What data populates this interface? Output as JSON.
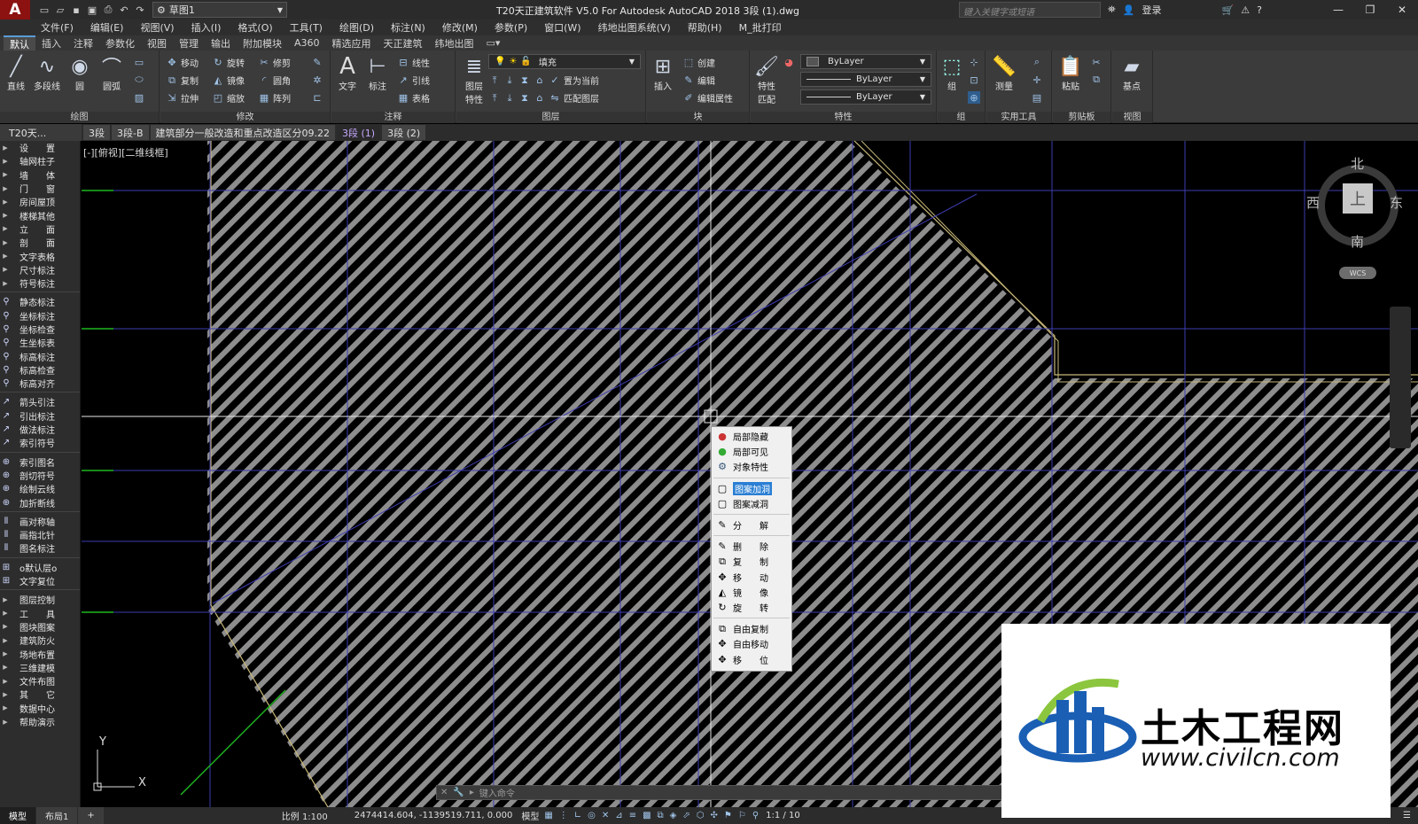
{
  "title_bar": {
    "logo": "A",
    "workspace": "草图1",
    "title": "T20天正建筑软件 V5.0 For Autodesk AutoCAD 2018    3段 (1).dwg",
    "search_placeholder": "键入关键字或短语",
    "login": "登录"
  },
  "menus": [
    "文件(F)",
    "编辑(E)",
    "视图(V)",
    "插入(I)",
    "格式(O)",
    "工具(T)",
    "绘图(D)",
    "标注(N)",
    "修改(M)",
    "参数(P)",
    "窗口(W)",
    "纬地出图系统(V)",
    "帮助(H)",
    "M_批打印"
  ],
  "ribbon_tabs": [
    "默认",
    "插入",
    "注释",
    "参数化",
    "视图",
    "管理",
    "输出",
    "附加模块",
    "A360",
    "精选应用",
    "天正建筑",
    "纬地出图"
  ],
  "ribbon": {
    "draw": {
      "label": "绘图",
      "buttons": [
        "直线",
        "多段线",
        "圆",
        "圆弧"
      ]
    },
    "modify": {
      "label": "修改",
      "rows": [
        [
          "移动",
          "旋转",
          "修剪"
        ],
        [
          "复制",
          "镜像",
          "圆角"
        ],
        [
          "拉伸",
          "缩放",
          "阵列"
        ]
      ]
    },
    "annotation": {
      "label": "注释",
      "buttons": [
        "文字",
        "标注"
      ],
      "rows": [
        "线性",
        "引线",
        "表格"
      ]
    },
    "layers": {
      "label": "图层",
      "button": "图层特性",
      "layer_combo": "填充",
      "rows": [
        "置为当前",
        "匹配图层"
      ]
    },
    "block": {
      "label": "块",
      "button": "插入",
      "rows": [
        "创建",
        "编辑",
        "编辑属性"
      ]
    },
    "properties": {
      "label": "特性",
      "button": "特性匹配",
      "combos": [
        "ByLayer",
        "ByLayer",
        "ByLayer"
      ]
    },
    "groups": {
      "label": "组",
      "button": "组"
    },
    "utilities": {
      "label": "实用工具",
      "button": "测量"
    },
    "clipboard": {
      "label": "剪贴板",
      "button": "粘贴"
    },
    "view": {
      "label": "视图",
      "button": "基点"
    }
  },
  "doc_tabs": {
    "panel_label": "T20天...",
    "tabs": [
      "3段",
      "3段-B",
      "建筑部分一般改造和重点改造区分09.22",
      "3段 (1)",
      "3段 (2)"
    ],
    "active": 3
  },
  "sidebar": {
    "group1": [
      "设　　置",
      "轴网柱子",
      "墙　　体",
      "门　　窗",
      "房间屋顶",
      "楼梯其他",
      "立　　面",
      "剖　　面",
      "文字表格",
      "尺寸标注",
      "符号标注"
    ],
    "group2": [
      "静态标注",
      "坐标标注",
      "坐标检查",
      "生坐标表",
      "标高标注",
      "标高检查",
      "标高对齐"
    ],
    "group3": [
      "箭头引注",
      "引出标注",
      "做法标注",
      "索引符号"
    ],
    "group4": [
      "索引图名",
      "剖切符号",
      "绘制云线",
      "加折断线"
    ],
    "group5": [
      "画对称轴",
      "画指北针",
      "图名标注"
    ],
    "group6": [
      "o默认层o",
      "文字复位"
    ],
    "group7": [
      "图层控制",
      "工　　具",
      "图块图案",
      "建筑防火",
      "场地布置",
      "三维建模",
      "文件布图",
      "其　　它",
      "数据中心",
      "帮助演示"
    ]
  },
  "viewport_label": "[-][俯视][二维线框]",
  "context_menu": {
    "group1": [
      "局部隐藏",
      "局部可见",
      "对象特性"
    ],
    "group2": [
      "图案加洞",
      "图案减洞"
    ],
    "group3": [
      "分　　解"
    ],
    "group4": [
      "删　　除",
      "复　　制",
      "移　　动",
      "镜　　像",
      "旋　　转"
    ],
    "group5": [
      "自由复制",
      "自由移动",
      "移　　位"
    ],
    "highlighted": "图案加洞"
  },
  "viewcube": {
    "north": "北",
    "south": "南",
    "east": "东",
    "west": "西",
    "face": "上",
    "wcs": "WCS"
  },
  "ucs": {
    "x": "X",
    "y": "Y"
  },
  "command_line": {
    "placeholder": "键入命令"
  },
  "status_bar": {
    "layouts": [
      "模型",
      "布局1"
    ],
    "scale": "比例 1:100",
    "coords": "2474414.604, -1139519.711, 0.000",
    "mode": "模型",
    "anno_scale": "1:1 / 10"
  },
  "watermark": {
    "name": "土木工程网",
    "url": "www.civilcn.com"
  },
  "colors": {
    "accent": "#2a7fd4",
    "hatch": "#8a8a8a",
    "grid_line": "#3d3db0",
    "outline": "#c8b878",
    "green_axis": "#1fb81f"
  }
}
